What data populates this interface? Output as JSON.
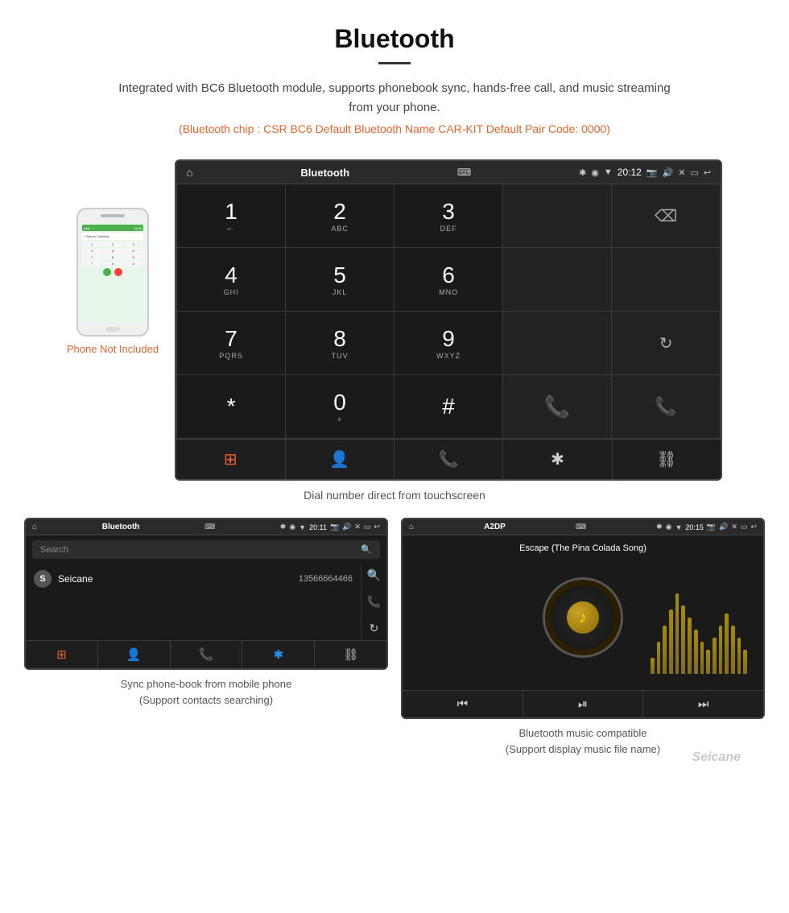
{
  "header": {
    "title": "Bluetooth",
    "description": "Integrated with BC6 Bluetooth module, supports phonebook sync, hands-free call, and music streaming from your phone.",
    "specs": "(Bluetooth chip : CSR BC6    Default Bluetooth Name CAR-KIT    Default Pair Code: 0000)"
  },
  "phone_illustration": {
    "not_included_label": "Phone Not Included"
  },
  "car_screen": {
    "title": "Bluetooth",
    "time": "20:12",
    "usb_icon": "⌨",
    "home_icon": "⌂",
    "back_icon": "↩",
    "dialpad": [
      {
        "num": "1",
        "sub": "⌐",
        "col": 0
      },
      {
        "num": "2",
        "sub": "ABC",
        "col": 1
      },
      {
        "num": "3",
        "sub": "DEF",
        "col": 2
      },
      {
        "num": "",
        "sub": "",
        "empty": true,
        "col": 3
      },
      {
        "num": "⌫",
        "sub": "",
        "backspace": true,
        "col": 4
      },
      {
        "num": "4",
        "sub": "GHI",
        "col": 0
      },
      {
        "num": "5",
        "sub": "JKL",
        "col": 1
      },
      {
        "num": "6",
        "sub": "MNO",
        "col": 2
      },
      {
        "num": "",
        "sub": "",
        "empty": true,
        "col": 3
      },
      {
        "num": "",
        "sub": "",
        "empty": true,
        "col": 4
      },
      {
        "num": "7",
        "sub": "PQRS",
        "col": 0
      },
      {
        "num": "8",
        "sub": "TUV",
        "col": 1
      },
      {
        "num": "9",
        "sub": "WXYZ",
        "col": 2
      },
      {
        "num": "",
        "sub": "",
        "empty": true,
        "col": 3
      },
      {
        "num": "↻",
        "sub": "",
        "refresh": true,
        "col": 4
      },
      {
        "num": "*",
        "sub": "",
        "col": 0
      },
      {
        "num": "0",
        "sub": "+",
        "col": 1
      },
      {
        "num": "#",
        "sub": "",
        "col": 2
      },
      {
        "num": "📞",
        "sub": "",
        "call": true,
        "col": 3
      },
      {
        "num": "📞",
        "sub": "",
        "end": true,
        "col": 4
      }
    ],
    "bottom_icons": [
      "⊞",
      "👤",
      "📞",
      "✱",
      "⛓"
    ]
  },
  "dial_caption": "Dial number direct from touchscreen",
  "phonebook_panel": {
    "title": "Bluetooth",
    "time": "20:11",
    "search_placeholder": "Search",
    "contact": {
      "letter": "S",
      "name": "Seicane",
      "number": "13566664466"
    },
    "bottom_icons": [
      "⊞",
      "👤",
      "📞",
      "✱",
      "⛓"
    ],
    "caption_line1": "Sync phone-book from mobile phone",
    "caption_line2": "(Support contacts searching)"
  },
  "music_panel": {
    "title": "A2DP",
    "time": "20:15",
    "song_title": "Escape (The Pina Colada Song)",
    "eq_bars": [
      20,
      40,
      60,
      80,
      100,
      85,
      70,
      55,
      40,
      30,
      45,
      60,
      75,
      60,
      45,
      30
    ],
    "caption_line1": "Bluetooth music compatible",
    "caption_line2": "(Support display music file name)"
  },
  "watermark": "Seicane"
}
